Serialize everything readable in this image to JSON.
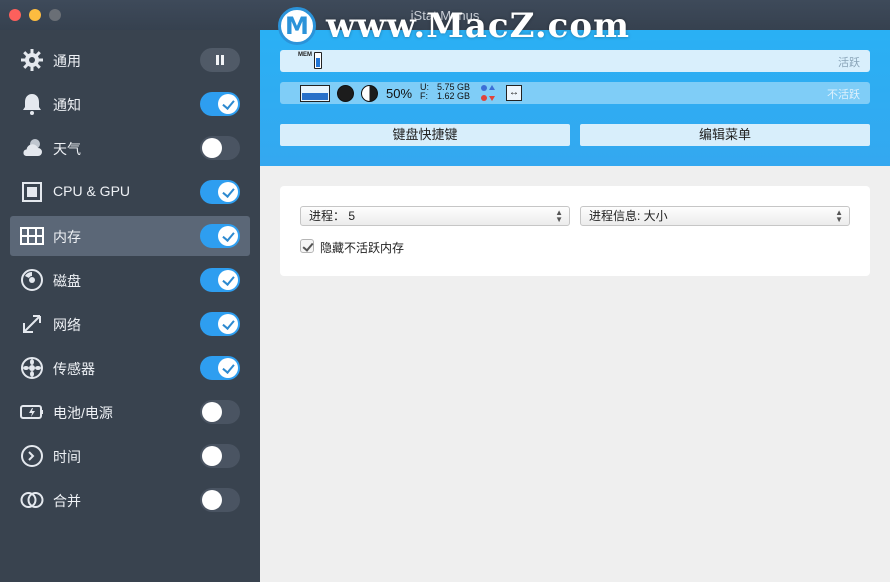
{
  "window": {
    "title": "iStat Menus"
  },
  "watermark": {
    "logo_letter": "M",
    "text": "www.MacZ.com"
  },
  "sidebar": {
    "items": [
      {
        "label": "通用",
        "control": "pause",
        "icon": "gear-icon"
      },
      {
        "label": "通知",
        "control": "on",
        "icon": "bell-icon"
      },
      {
        "label": "天气",
        "control": "off",
        "icon": "cloud-sun-icon"
      },
      {
        "label": "CPU & GPU",
        "control": "on",
        "icon": "cpu-chip-icon"
      },
      {
        "label": "内存",
        "control": "on",
        "icon": "memory-icon",
        "active": true
      },
      {
        "label": "磁盘",
        "control": "on",
        "icon": "disk-icon"
      },
      {
        "label": "网络",
        "control": "on",
        "icon": "network-arrows-icon"
      },
      {
        "label": "传感器",
        "control": "on",
        "icon": "sensor-fan-icon"
      },
      {
        "label": "电池/电源",
        "control": "off",
        "icon": "battery-icon"
      },
      {
        "label": "时间",
        "control": "off",
        "icon": "clock-icon"
      },
      {
        "label": "合并",
        "control": "off",
        "icon": "combine-circles-icon"
      }
    ]
  },
  "menubar": {
    "active_label": "活跃",
    "inactive_label": "不活跃",
    "mem_vertical_text": "MEM",
    "percent": "50%",
    "used_label": "U:",
    "free_label": "F:",
    "used_value": "5.75 GB",
    "free_value": "1.62 GB",
    "arrows_glyph": "↔"
  },
  "buttons": {
    "keyboard_shortcuts": "键盘快捷键",
    "edit_menu": "编辑菜单"
  },
  "settings": {
    "process_select": "进程： 5",
    "process_info_select": "进程信息: 大小",
    "hide_inactive_label": "隐藏不活跃内存",
    "hide_inactive_checked": true
  },
  "colors": {
    "accent": "#2e9ef0",
    "sidebar_bg": "#39434f",
    "header_blue": "#2ab0f4"
  }
}
